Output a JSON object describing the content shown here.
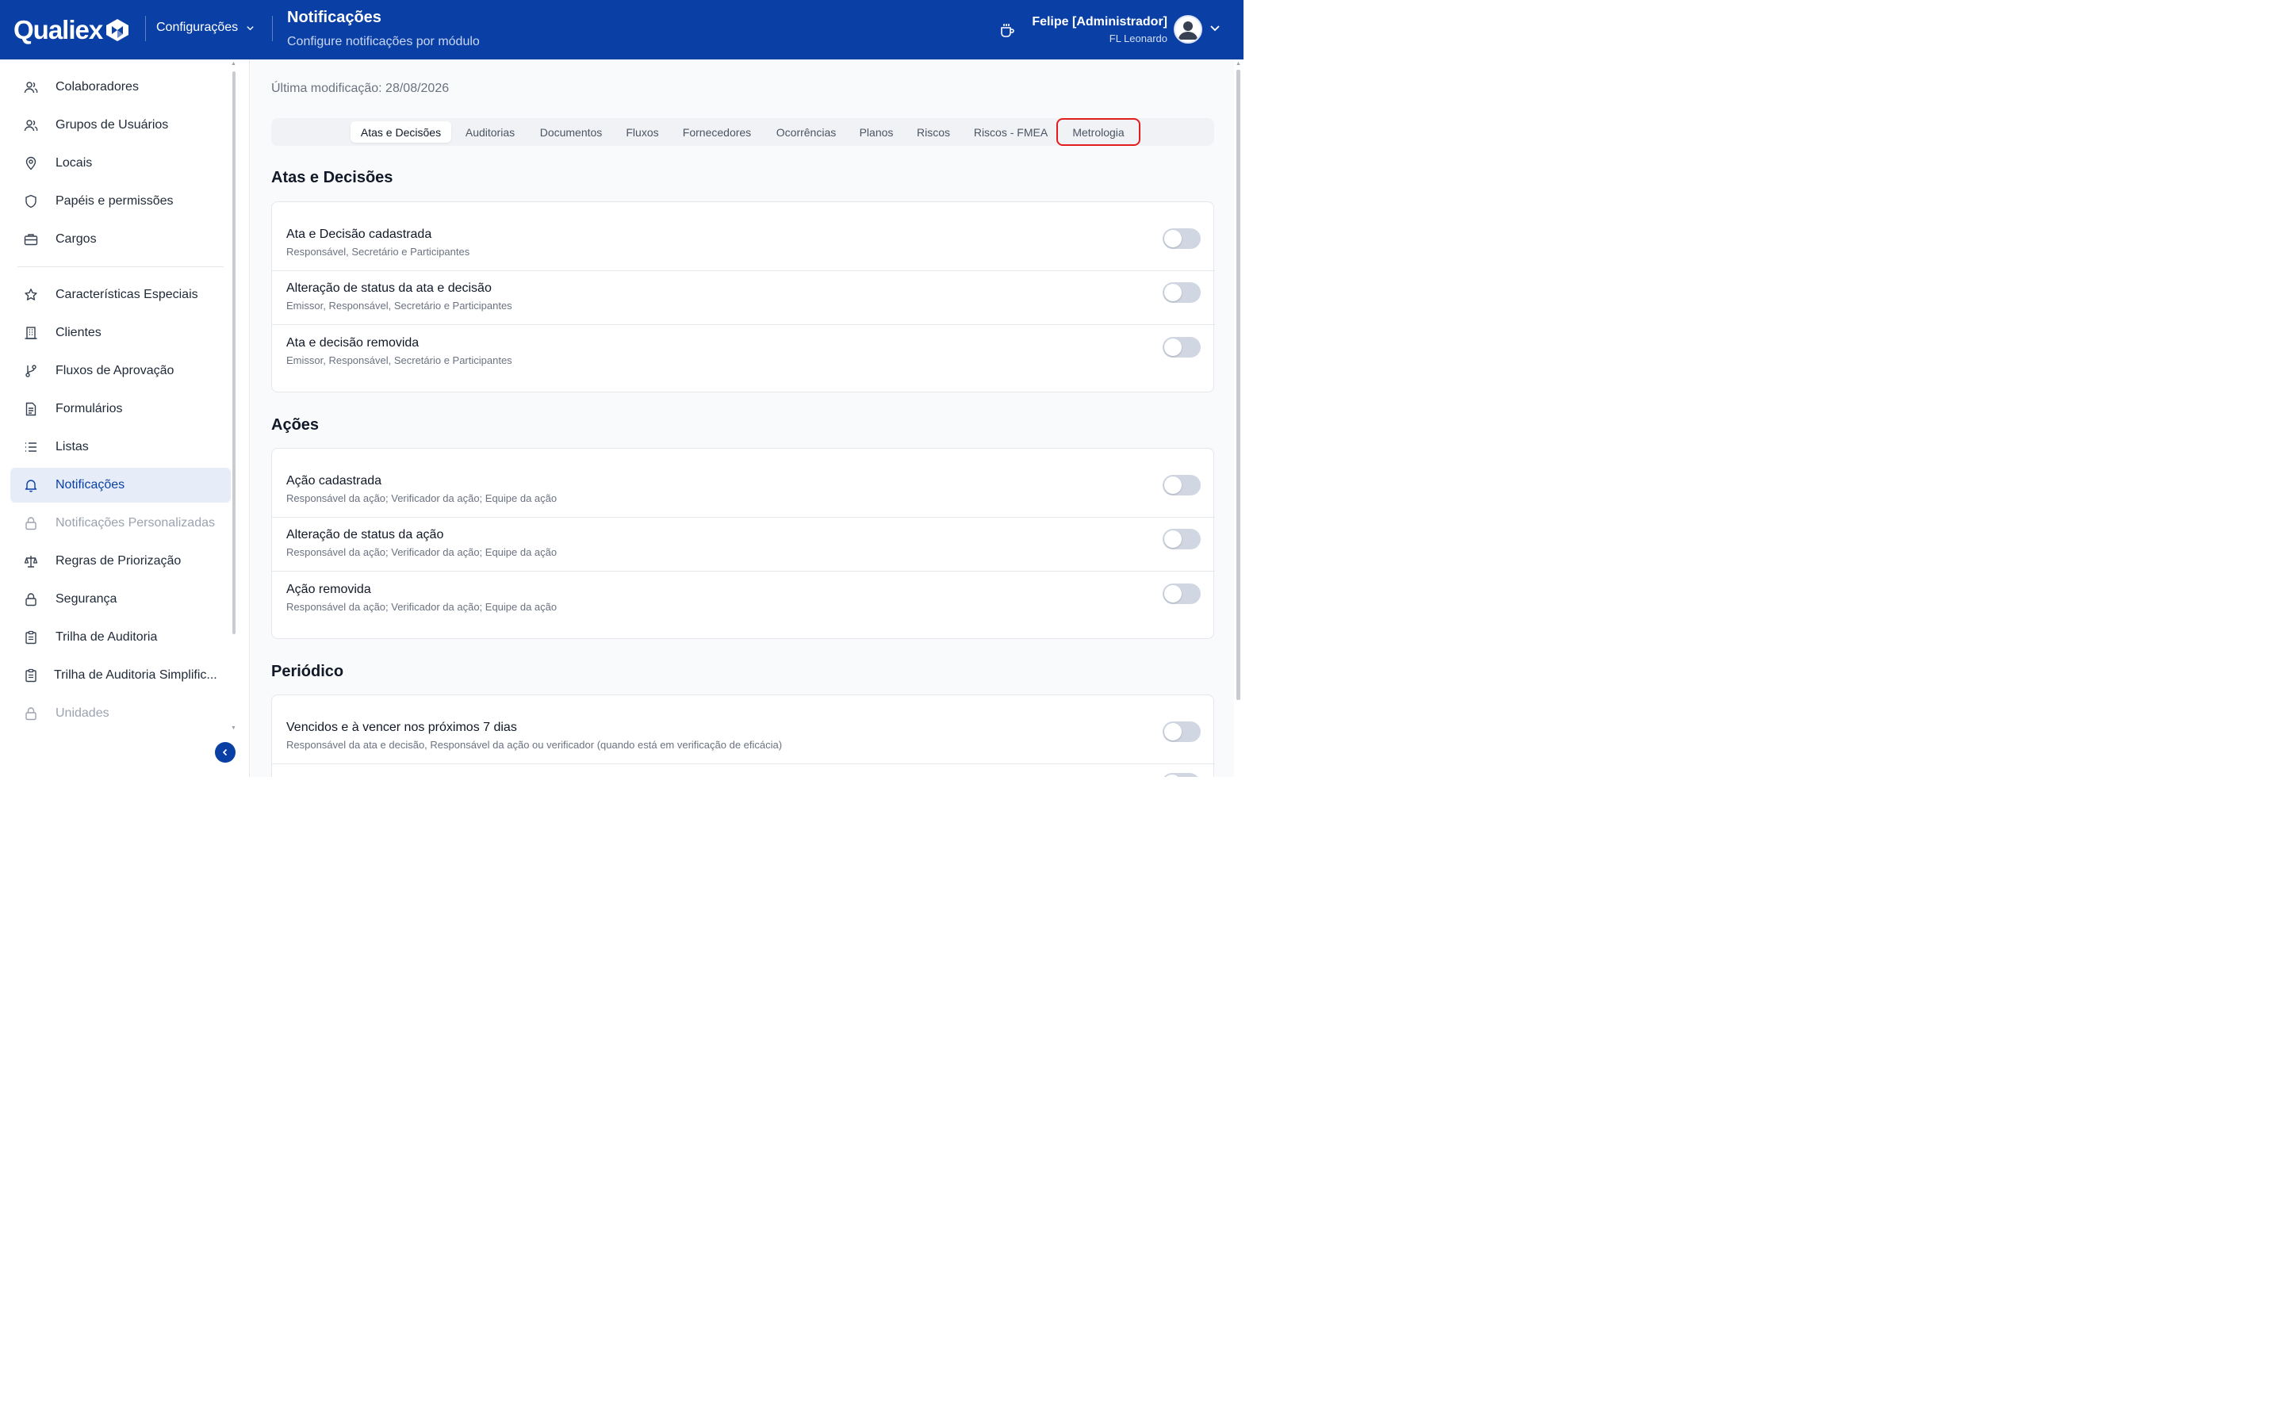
{
  "header": {
    "logo_text": "Qualiex",
    "module_select": "Configurações",
    "page_title": "Notificações",
    "page_subtitle": "Configure notificações por módulo",
    "user_name": "Felipe [Administrador]",
    "user_org": "FL Leonardo"
  },
  "sidebar": {
    "items": [
      {
        "label": "Colaboradores",
        "icon": "users-icon",
        "state": "normal"
      },
      {
        "label": "Grupos de Usuários",
        "icon": "user-group-icon",
        "state": "normal"
      },
      {
        "label": "Locais",
        "icon": "map-pin-icon",
        "state": "normal"
      },
      {
        "label": "Papéis e permissões",
        "icon": "shield-icon",
        "state": "normal"
      },
      {
        "label": "Cargos",
        "icon": "briefcase-icon",
        "state": "normal"
      },
      {
        "label": "Características Especiais",
        "icon": "star-icon",
        "state": "normal"
      },
      {
        "label": "Clientes",
        "icon": "building-icon",
        "state": "normal"
      },
      {
        "label": "Fluxos de Aprovação",
        "icon": "git-branch-icon",
        "state": "normal"
      },
      {
        "label": "Formulários",
        "icon": "file-text-icon",
        "state": "normal"
      },
      {
        "label": "Listas",
        "icon": "list-icon",
        "state": "normal"
      },
      {
        "label": "Notificações",
        "icon": "bell-icon",
        "state": "active"
      },
      {
        "label": "Notificações Personalizadas",
        "icon": "lock-icon",
        "state": "disabled"
      },
      {
        "label": "Regras de Priorização",
        "icon": "scale-icon",
        "state": "normal"
      },
      {
        "label": "Segurança",
        "icon": "lock-icon",
        "state": "normal"
      },
      {
        "label": "Trilha de Auditoria",
        "icon": "clipboard-icon",
        "state": "normal"
      },
      {
        "label": "Trilha de Auditoria Simplific...",
        "icon": "clipboard-icon",
        "state": "normal"
      },
      {
        "label": "Unidades",
        "icon": "lock-icon",
        "state": "disabled"
      }
    ]
  },
  "main": {
    "last_modified": "Última modificação: 28/08/2026",
    "tabs": [
      {
        "label": "Atas e Decisões",
        "active": true
      },
      {
        "label": "Auditorias",
        "active": false
      },
      {
        "label": "Documentos",
        "active": false
      },
      {
        "label": "Fluxos",
        "active": false
      },
      {
        "label": "Fornecedores",
        "active": false
      },
      {
        "label": "Ocorrências",
        "active": false
      },
      {
        "label": "Planos",
        "active": false
      },
      {
        "label": "Riscos",
        "active": false
      },
      {
        "label": "Riscos - FMEA",
        "active": false
      },
      {
        "label": "Metrologia",
        "active": false
      }
    ],
    "sections": [
      {
        "title": "Atas e Decisões",
        "rows": [
          {
            "title": "Ata e Decisão cadastrada",
            "desc": "Responsável, Secretário e Participantes",
            "enabled": false
          },
          {
            "title": "Alteração de status da ata e decisão",
            "desc": "Emissor, Responsável, Secretário e Participantes",
            "enabled": false
          },
          {
            "title": "Ata e decisão removida",
            "desc": "Emissor, Responsável, Secretário e Participantes",
            "enabled": false
          }
        ]
      },
      {
        "title": "Ações",
        "rows": [
          {
            "title": "Ação cadastrada",
            "desc": "Responsável da ação; Verificador da ação; Equipe da ação",
            "enabled": false
          },
          {
            "title": "Alteração de status da ação",
            "desc": "Responsável da ação; Verificador da ação; Equipe da ação",
            "enabled": false
          },
          {
            "title": "Ação removida",
            "desc": "Responsável da ação; Verificador da ação; Equipe da ação",
            "enabled": false
          }
        ]
      },
      {
        "title": "Periódico",
        "rows": [
          {
            "title": "Vencidos e à vencer nos próximos 7 dias",
            "desc": "Responsável da ata e decisão, Responsável da ação ou verificador (quando está em verificação de eficácia)",
            "enabled": false
          }
        ]
      }
    ]
  },
  "colors": {
    "header_bg": "#0a40a6",
    "active_item_bg": "#e7edf8",
    "highlight_border": "#e11d1d",
    "toggle_off": "#d1d7e2"
  }
}
